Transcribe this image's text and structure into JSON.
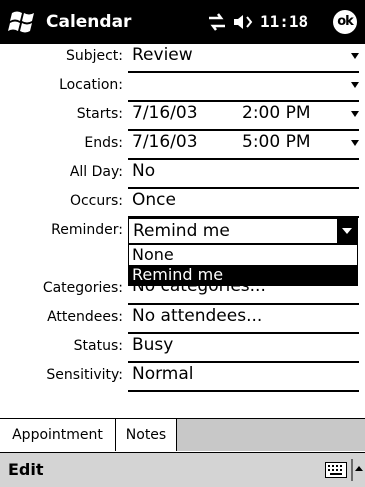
{
  "titlebar": {
    "app_title": "Calendar",
    "clock": "11:18",
    "ok_label": "ok"
  },
  "form": {
    "subject": {
      "label": "Subject:",
      "value": "Review"
    },
    "location": {
      "label": "Location:",
      "value": ""
    },
    "starts": {
      "label": "Starts:",
      "date": "7/16/03",
      "time": "2:00 PM"
    },
    "ends": {
      "label": "Ends:",
      "date": "7/16/03",
      "time": "5:00 PM"
    },
    "all_day": {
      "label": "All Day:",
      "value": "No"
    },
    "occurs": {
      "label": "Occurs:",
      "value": "Once"
    },
    "reminder": {
      "label": "Reminder:",
      "value": "Remind me",
      "options": [
        "None",
        "Remind me"
      ]
    },
    "categories": {
      "label": "Categories:",
      "value": "No categories..."
    },
    "attendees": {
      "label": "Attendees:",
      "value": "No attendees..."
    },
    "status": {
      "label": "Status:",
      "value": "Busy"
    },
    "sensitivity": {
      "label": "Sensitivity:",
      "value": "Normal"
    }
  },
  "tabs": [
    {
      "label": "Appointment"
    },
    {
      "label": "Notes"
    }
  ],
  "menubar": {
    "edit_label": "Edit"
  }
}
